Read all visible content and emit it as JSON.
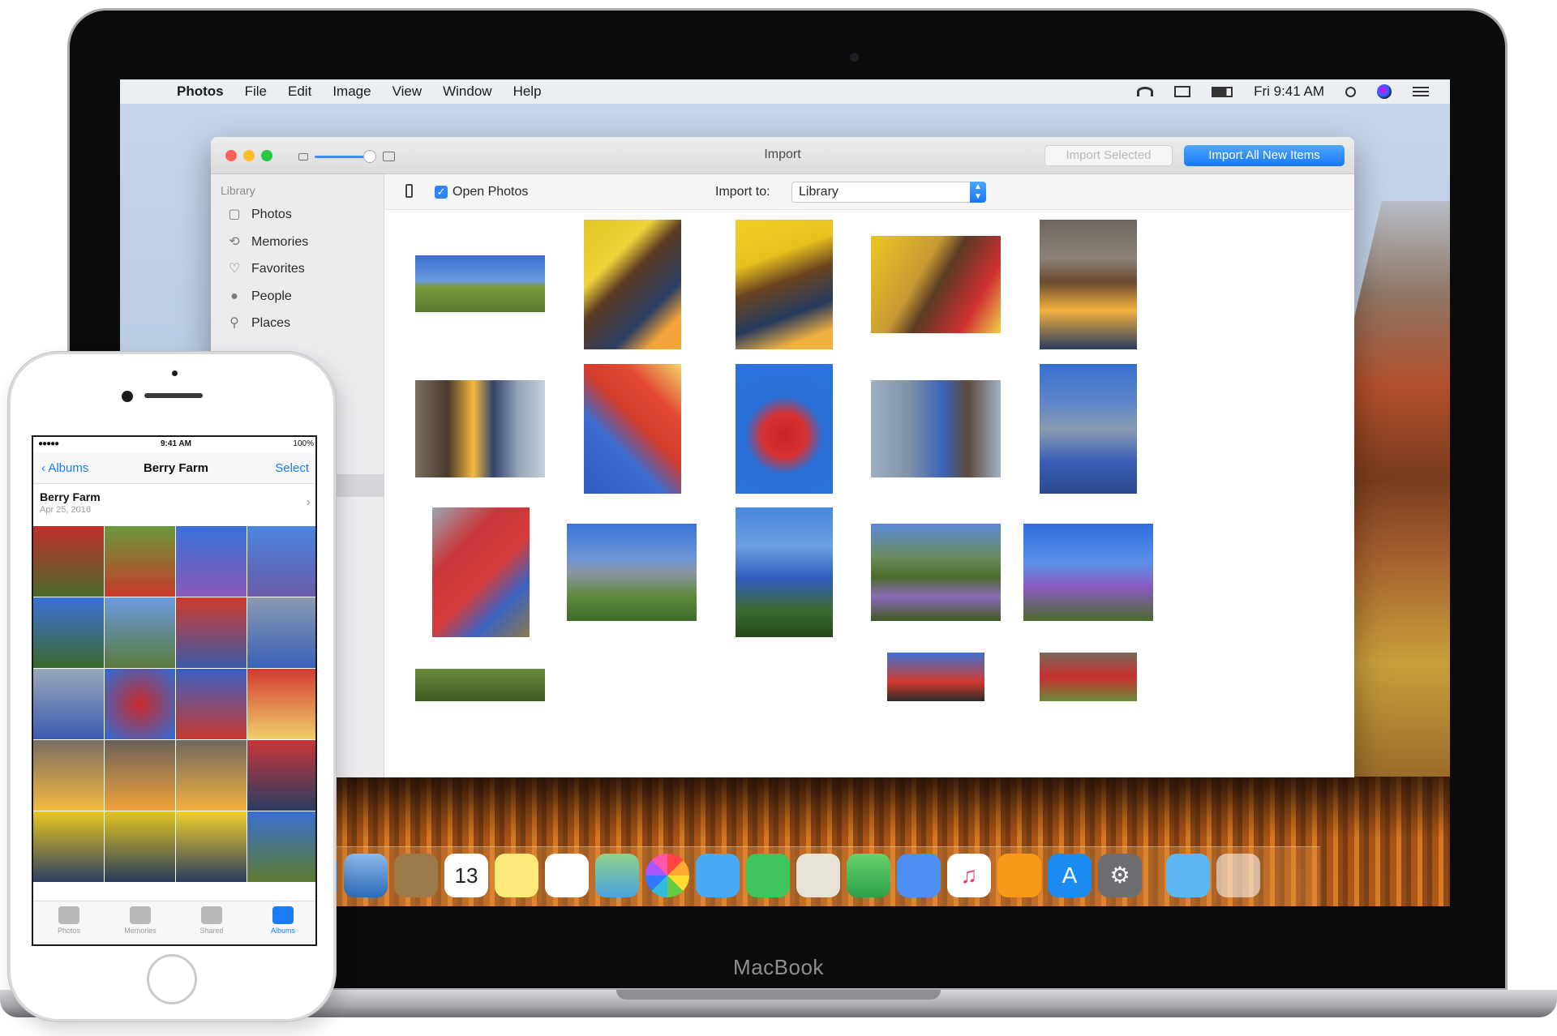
{
  "menubar": {
    "app": "Photos",
    "items": [
      "File",
      "Edit",
      "Image",
      "View",
      "Window",
      "Help"
    ],
    "clock": "Fri 9:41 AM"
  },
  "import_window": {
    "title": "Import",
    "import_selected": "Import Selected",
    "import_all": "Import All New Items",
    "open_photos": "Open Photos",
    "import_to_label": "Import to:",
    "import_to_value": "Library"
  },
  "sidebar": {
    "heading": "Library",
    "items": [
      {
        "label": "Photos",
        "icon": "photos-icon"
      },
      {
        "label": "Memories",
        "icon": "memories-icon"
      },
      {
        "label": "Favorites",
        "icon": "heart-icon"
      },
      {
        "label": "People",
        "icon": "person-icon"
      },
      {
        "label": "Places",
        "icon": "pin-icon"
      }
    ]
  },
  "dock": {
    "calendar_day": "13"
  },
  "macbook_label": "MacBook",
  "iphone": {
    "status_time": "9:41 AM",
    "status_battery": "100%",
    "back_label": "Albums",
    "title": "Berry Farm",
    "select_label": "Select",
    "album_name": "Berry Farm",
    "album_date": "Apr 25, 2016",
    "tabs": [
      "Photos",
      "Memories",
      "Shared",
      "Albums"
    ]
  }
}
